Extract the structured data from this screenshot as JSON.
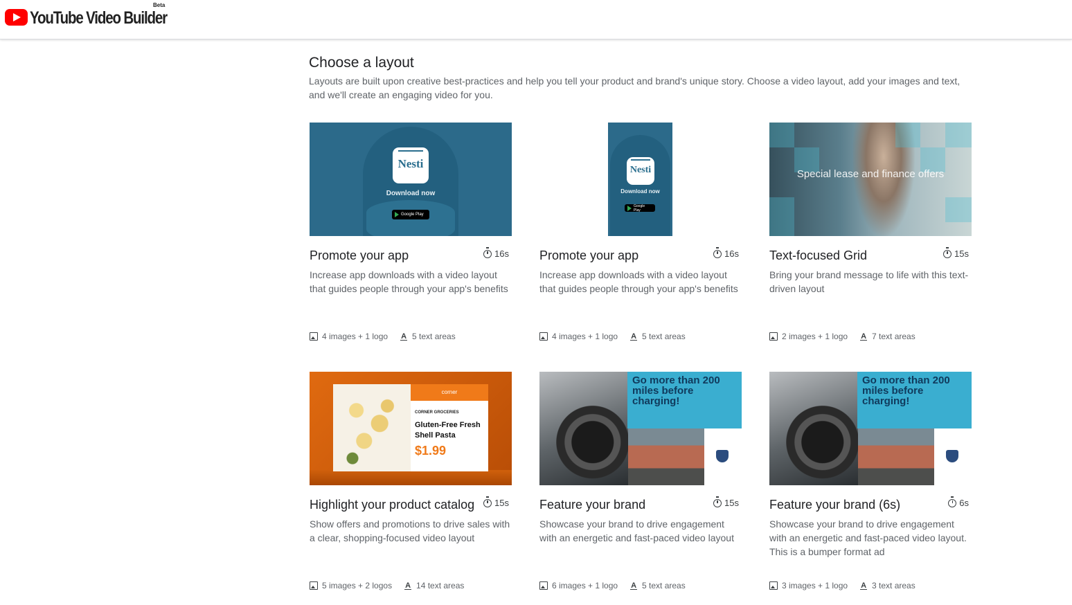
{
  "header": {
    "brand_name": "YouTube Video Builder",
    "beta_label": "Beta"
  },
  "page": {
    "title": "Choose a layout",
    "description": "Layouts are built upon creative best-practices and help you tell your product and brand's unique story. Choose a video layout, add your images and text, and we'll create an engaging video for you."
  },
  "layouts": [
    {
      "title": "Promote your app",
      "duration": "16s",
      "description": "Increase app downloads with a video layout that guides people through your app's benefits",
      "images": "4 images + 1 logo",
      "text_areas": "5 text areas",
      "thumb": {
        "app_name": "Nesti",
        "cta": "Download now",
        "store": "Google Play"
      }
    },
    {
      "title": "Promote your app",
      "duration": "16s",
      "description": "Increase app downloads with a video layout that guides people through your app's benefits",
      "images": "4 images + 1 logo",
      "text_areas": "5 text areas",
      "thumb": {
        "app_name": "Nesti",
        "cta": "Download now",
        "store": "Google Play"
      }
    },
    {
      "title": "Text-focused Grid",
      "duration": "15s",
      "description": "Bring your brand message to life with this text-driven layout",
      "images": "2 images + 1 logo",
      "text_areas": "7 text areas",
      "thumb": {
        "caption": "Special lease and finance offers"
      }
    },
    {
      "title": "Highlight your product catalog",
      "duration": "15s",
      "description": "Show offers and promotions to drive sales with a clear, shopping-focused video layout",
      "images": "5 images + 2 logos",
      "text_areas": "14 text areas",
      "thumb": {
        "store": "corner",
        "category": "CORNER GROCERIES",
        "product": "Gluten-Free Fresh Shell Pasta",
        "price": "$1.99"
      }
    },
    {
      "title": "Feature your brand",
      "duration": "15s",
      "description": "Showcase your brand to drive engagement with an energetic and fast-paced video layout",
      "images": "6 images + 1 logo",
      "text_areas": "5 text areas",
      "thumb": {
        "headline": "Go more than 200 miles before charging!"
      }
    },
    {
      "title": "Feature your brand (6s)",
      "duration": "6s",
      "description": "Showcase your brand to drive engagement with an energetic and fast-paced video layout. This is a bumper format ad",
      "images": "3 images + 1 logo",
      "text_areas": "3 text areas",
      "thumb": {
        "headline": "Go more than 200 miles before charging!"
      }
    }
  ]
}
